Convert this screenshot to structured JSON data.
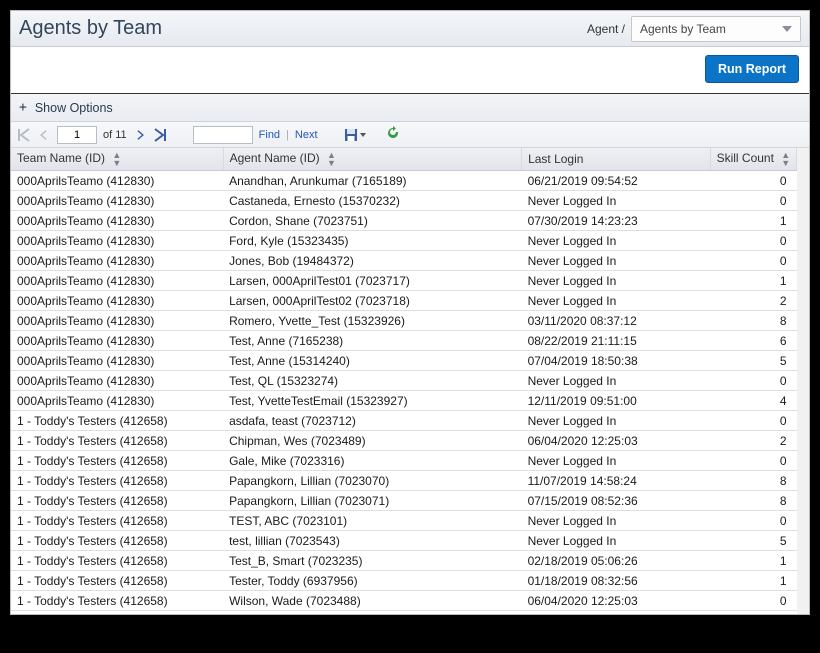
{
  "header": {
    "title": "Agents by Team",
    "breadcrumb_label": "Agent /",
    "dropdown_value": "Agents by Team"
  },
  "actions": {
    "run_report_label": "Run Report"
  },
  "options": {
    "show_options_label": "Show Options"
  },
  "pager": {
    "current_page": "1",
    "of_label": "of 11",
    "find_label": "Find",
    "next_label": "Next"
  },
  "columns": {
    "team": "Team Name (ID)",
    "agent": "Agent Name (ID)",
    "last_login": "Last Login",
    "skill_count": "Skill Count"
  },
  "rows": [
    {
      "team": "000AprilsTeamo (412830)",
      "agent": "Anandhan, Arunkumar (7165189)",
      "last_login": "06/21/2019 09:54:52",
      "skill_count": "0"
    },
    {
      "team": "000AprilsTeamo (412830)",
      "agent": "Castaneda, Ernesto (15370232)",
      "last_login": "Never Logged In",
      "skill_count": "0"
    },
    {
      "team": "000AprilsTeamo (412830)",
      "agent": "Cordon, Shane (7023751)",
      "last_login": "07/30/2019 14:23:23",
      "skill_count": "1"
    },
    {
      "team": "000AprilsTeamo (412830)",
      "agent": "Ford, Kyle (15323435)",
      "last_login": "Never Logged In",
      "skill_count": "0"
    },
    {
      "team": "000AprilsTeamo (412830)",
      "agent": "Jones, Bob (19484372)",
      "last_login": "Never Logged In",
      "skill_count": "0"
    },
    {
      "team": "000AprilsTeamo (412830)",
      "agent": "Larsen, 000AprilTest01 (7023717)",
      "last_login": "Never Logged In",
      "skill_count": "1"
    },
    {
      "team": "000AprilsTeamo (412830)",
      "agent": "Larsen, 000AprilTest02 (7023718)",
      "last_login": "Never Logged In",
      "skill_count": "2"
    },
    {
      "team": "000AprilsTeamo (412830)",
      "agent": "Romero, Yvette_Test (15323926)",
      "last_login": "03/11/2020 08:37:12",
      "skill_count": "8"
    },
    {
      "team": "000AprilsTeamo (412830)",
      "agent": "Test, Anne (7165238)",
      "last_login": "08/22/2019 21:11:15",
      "skill_count": "6"
    },
    {
      "team": "000AprilsTeamo (412830)",
      "agent": "Test, Anne (15314240)",
      "last_login": "07/04/2019 18:50:38",
      "skill_count": "5"
    },
    {
      "team": "000AprilsTeamo (412830)",
      "agent": "Test, QL (15323274)",
      "last_login": "Never Logged In",
      "skill_count": "0"
    },
    {
      "team": "000AprilsTeamo (412830)",
      "agent": "Test, YvetteTestEmail (15323927)",
      "last_login": "12/11/2019 09:51:00",
      "skill_count": "4"
    },
    {
      "team": "1 - Toddy's Testers (412658)",
      "agent": "asdafa, teast (7023712)",
      "last_login": "Never Logged In",
      "skill_count": "0"
    },
    {
      "team": "1 - Toddy's Testers (412658)",
      "agent": "Chipman, Wes (7023489)",
      "last_login": "06/04/2020 12:25:03",
      "skill_count": "2"
    },
    {
      "team": "1 - Toddy's Testers (412658)",
      "agent": "Gale, Mike (7023316)",
      "last_login": "Never Logged In",
      "skill_count": "0"
    },
    {
      "team": "1 - Toddy's Testers (412658)",
      "agent": "Papangkorn, Lillian (7023070)",
      "last_login": "11/07/2019 14:58:24",
      "skill_count": "8"
    },
    {
      "team": "1 - Toddy's Testers (412658)",
      "agent": "Papangkorn, Lillian (7023071)",
      "last_login": "07/15/2019 08:52:36",
      "skill_count": "8"
    },
    {
      "team": "1 - Toddy's Testers (412658)",
      "agent": "TEST, ABC (7023101)",
      "last_login": "Never Logged In",
      "skill_count": "0"
    },
    {
      "team": "1 - Toddy's Testers (412658)",
      "agent": "test, lillian (7023543)",
      "last_login": "Never Logged In",
      "skill_count": "5"
    },
    {
      "team": "1 - Toddy's Testers (412658)",
      "agent": "Test_B, Smart (7023235)",
      "last_login": "02/18/2019 05:06:26",
      "skill_count": "1"
    },
    {
      "team": "1 - Toddy's Testers (412658)",
      "agent": "Tester, Toddy (6937956)",
      "last_login": "01/18/2019 08:32:56",
      "skill_count": "1"
    },
    {
      "team": "1 - Toddy's Testers (412658)",
      "agent": "Wilson, Wade (7023488)",
      "last_login": "06/04/2020 12:25:03",
      "skill_count": "0"
    }
  ]
}
